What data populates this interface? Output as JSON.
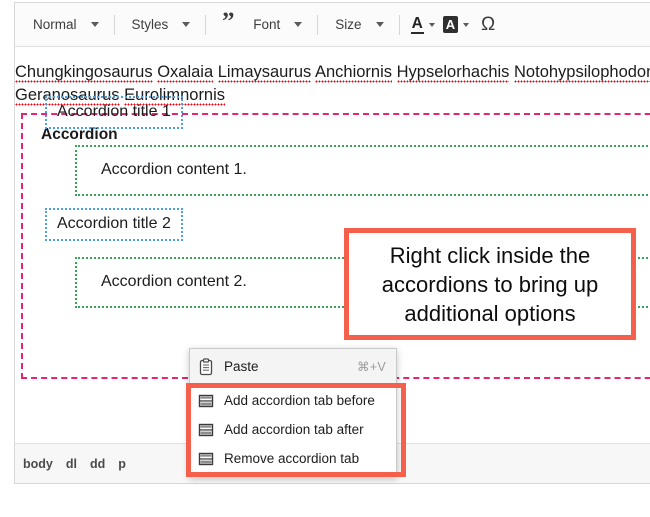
{
  "toolbar": {
    "format_select": {
      "label": "Normal",
      "icon": "chevron-down-icon"
    },
    "styles_select": {
      "label": "Styles",
      "icon": "chevron-down-icon"
    },
    "blockquote_button": {
      "label": "”",
      "icon": "blockquote-icon"
    },
    "font_select": {
      "label": "Font",
      "icon": "chevron-down-icon"
    },
    "size_select": {
      "label": "Size",
      "icon": "chevron-down-icon"
    },
    "text_color_button": {
      "label": "A",
      "icon": "text-color-icon"
    },
    "background_color_button": {
      "label": "A",
      "icon": "background-color-icon"
    },
    "special_char_button": {
      "label": "Ω",
      "icon": "omega-icon"
    }
  },
  "document": {
    "paragraph_words": [
      "Chungkingosaurus",
      "Oxalaia",
      "Limaysaurus",
      "Anchiornis",
      "Hypselorhachis",
      "Notohypsilophodon",
      "Geranosaurus",
      "Eurolimnornis"
    ],
    "accordion": {
      "heading": "Accordion",
      "items": [
        {
          "title": "Accordion title 1",
          "content": "Accordion content 1."
        },
        {
          "title": "Accordion title 2",
          "content": "Accordion content 2."
        }
      ]
    }
  },
  "annotation": {
    "text": "Right click inside the accordions to bring up additional options",
    "border_color": "#f4604b"
  },
  "context_menu": {
    "items": [
      {
        "label": "Paste",
        "shortcut": "⌘+V",
        "icon": "clipboard-icon"
      },
      {
        "label": "Add accordion tab before",
        "shortcut": "",
        "icon": "accordion-icon"
      },
      {
        "label": "Add accordion tab after",
        "shortcut": "",
        "icon": "accordion-icon"
      },
      {
        "label": "Remove accordion tab",
        "shortcut": "",
        "icon": "accordion-icon"
      }
    ]
  },
  "status_bar": {
    "element_path": [
      "body",
      "dl",
      "dd",
      "p"
    ]
  },
  "colors": {
    "dl_border": "#e5256f",
    "dt_border": "#4a9fe8",
    "dd_border": "#39a35a",
    "spellcheck": "#f0000e",
    "highlight": "#f4604b"
  }
}
